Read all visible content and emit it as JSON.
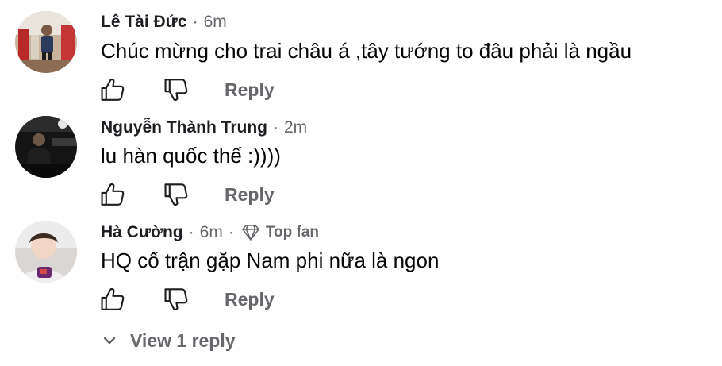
{
  "comments": [
    {
      "author": "Lê Tài Đức",
      "time": "6m",
      "text": "Chúc mừng cho trai châu á ,tây tướng to đâu phải là ngầu",
      "reply_label": "Reply",
      "avatar": "avatar-photo"
    },
    {
      "author": "Nguyễn Thành Trung",
      "time": "2m",
      "text": "lu hàn quốc thế :))))",
      "reply_label": "Reply",
      "avatar": "avatar-photo"
    },
    {
      "author": "Hà Cường",
      "time": "6m",
      "badge": "Top fan",
      "badge_icon": "diamond-icon",
      "text": "HQ cố trận gặp Nam phi nữa là ngon",
      "reply_label": "Reply",
      "avatar": "avatar-photo"
    }
  ],
  "view_replies": "View 1 reply",
  "separator": "·",
  "icons": {
    "like": "thumbs-up-icon",
    "dislike": "thumbs-down-icon",
    "expand": "chevron-down-icon"
  },
  "colors": {
    "name": "#1c1e21",
    "secondary": "#65676b",
    "text": "#050505"
  }
}
